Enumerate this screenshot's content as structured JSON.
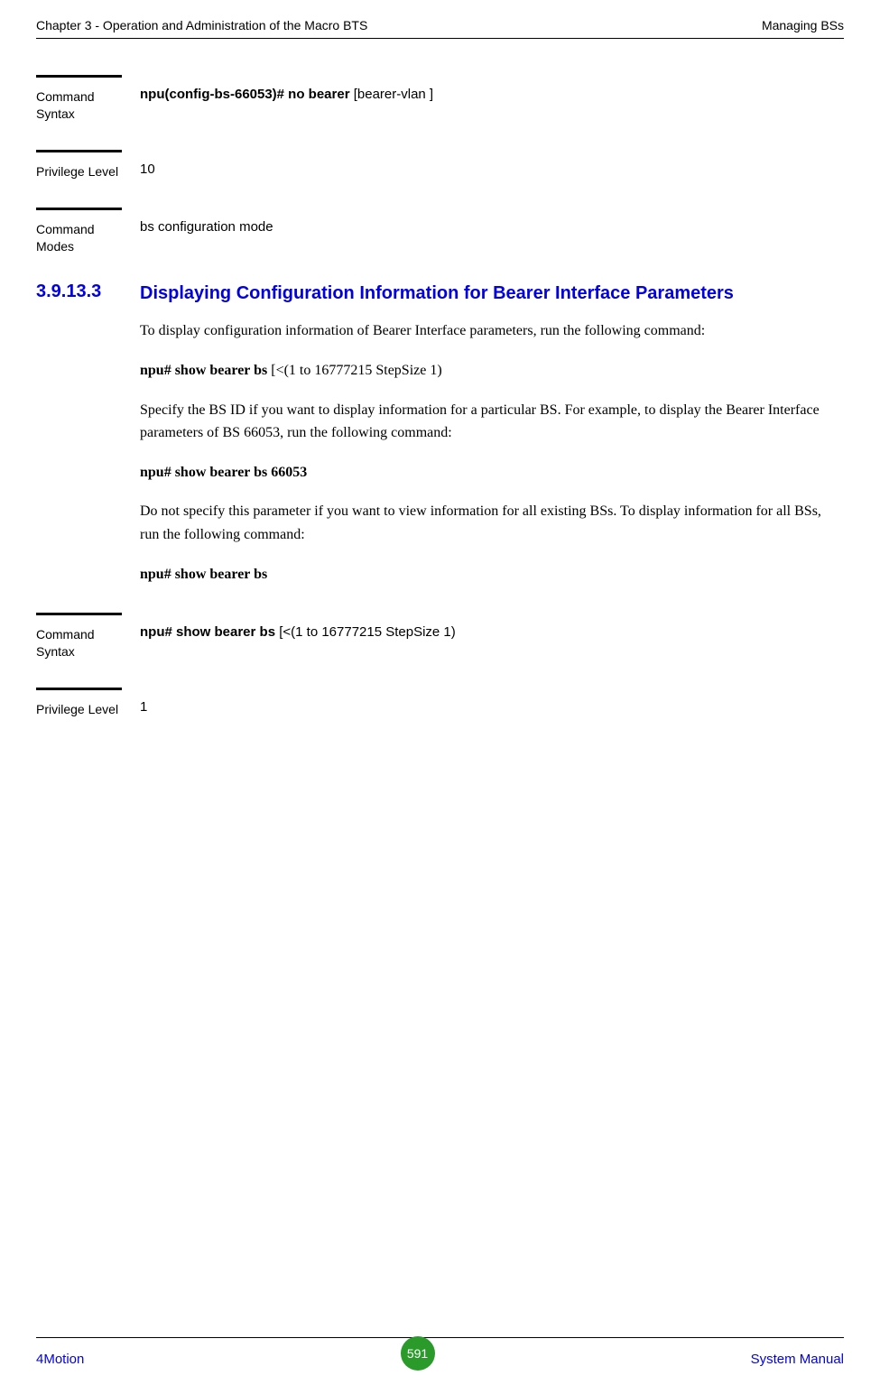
{
  "header": {
    "left": "Chapter 3 - Operation and Administration of the Macro BTS",
    "right": "Managing BSs"
  },
  "block1": {
    "label": "Command Syntax",
    "cmd_bold": "npu(config-bs-66053)# no bearer",
    "cmd_plain": " [bearer-vlan ]"
  },
  "block2": {
    "label": "Privilege Level",
    "value": "10"
  },
  "block3": {
    "label": "Command Modes",
    "value": "bs configuration mode"
  },
  "section": {
    "num": "3.9.13.3",
    "title": "Displaying Configuration Information for Bearer Interface Parameters"
  },
  "para1": "To display configuration information of Bearer Interface parameters, run the following command:",
  "para2_bold": "npu# show bearer bs",
  "para2_plain": " [<(1 to 16777215 StepSize 1)",
  "para3": "Specify the BS ID if you want to display information for a particular BS. For example, to display the Bearer Interface parameters of BS 66053, run the following command:",
  "para4_bold": "npu# show bearer bs 66053",
  "para5": "Do not specify this parameter if you want to view information for all existing BSs. To display information for all BSs, run the following command:",
  "para6_bold": "npu# show bearer bs",
  "block4": {
    "label": "Command Syntax",
    "cmd_bold": "npu# show bearer bs",
    "cmd_plain": " [<(1 to 16777215 StepSize 1)"
  },
  "block5": {
    "label": "Privilege Level",
    "value": "1"
  },
  "footer": {
    "left": "4Motion",
    "page": "591",
    "right": "System Manual"
  }
}
